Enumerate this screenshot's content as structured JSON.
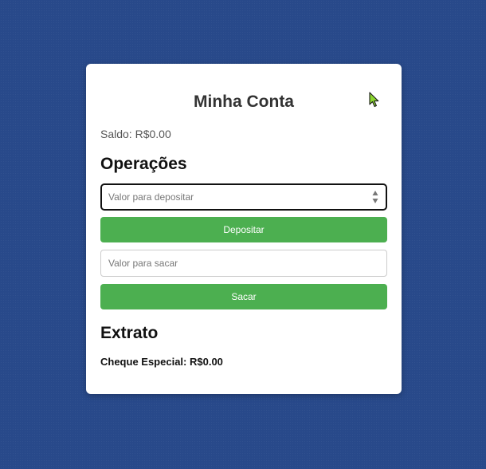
{
  "app": {
    "title": "Minha Conta"
  },
  "account": {
    "balance_label": "Saldo: R$0.00"
  },
  "operations": {
    "heading": "Operações",
    "deposit": {
      "placeholder": "Valor para depositar",
      "value": "",
      "button_label": "Depositar"
    },
    "withdraw": {
      "placeholder": "Valor para sacar",
      "value": "",
      "button_label": "Sacar"
    }
  },
  "statement": {
    "heading": "Extrato",
    "overdraft_label": "Cheque Especial: R$0.00"
  },
  "icons": {
    "cursor": "mouse-cursor-icon",
    "spinner": "number-spinner-icon"
  },
  "colors": {
    "background": "#28498a",
    "card": "#ffffff",
    "button": "#4caf50",
    "button_text": "#ffffff",
    "cursor": "#8bd62f"
  }
}
